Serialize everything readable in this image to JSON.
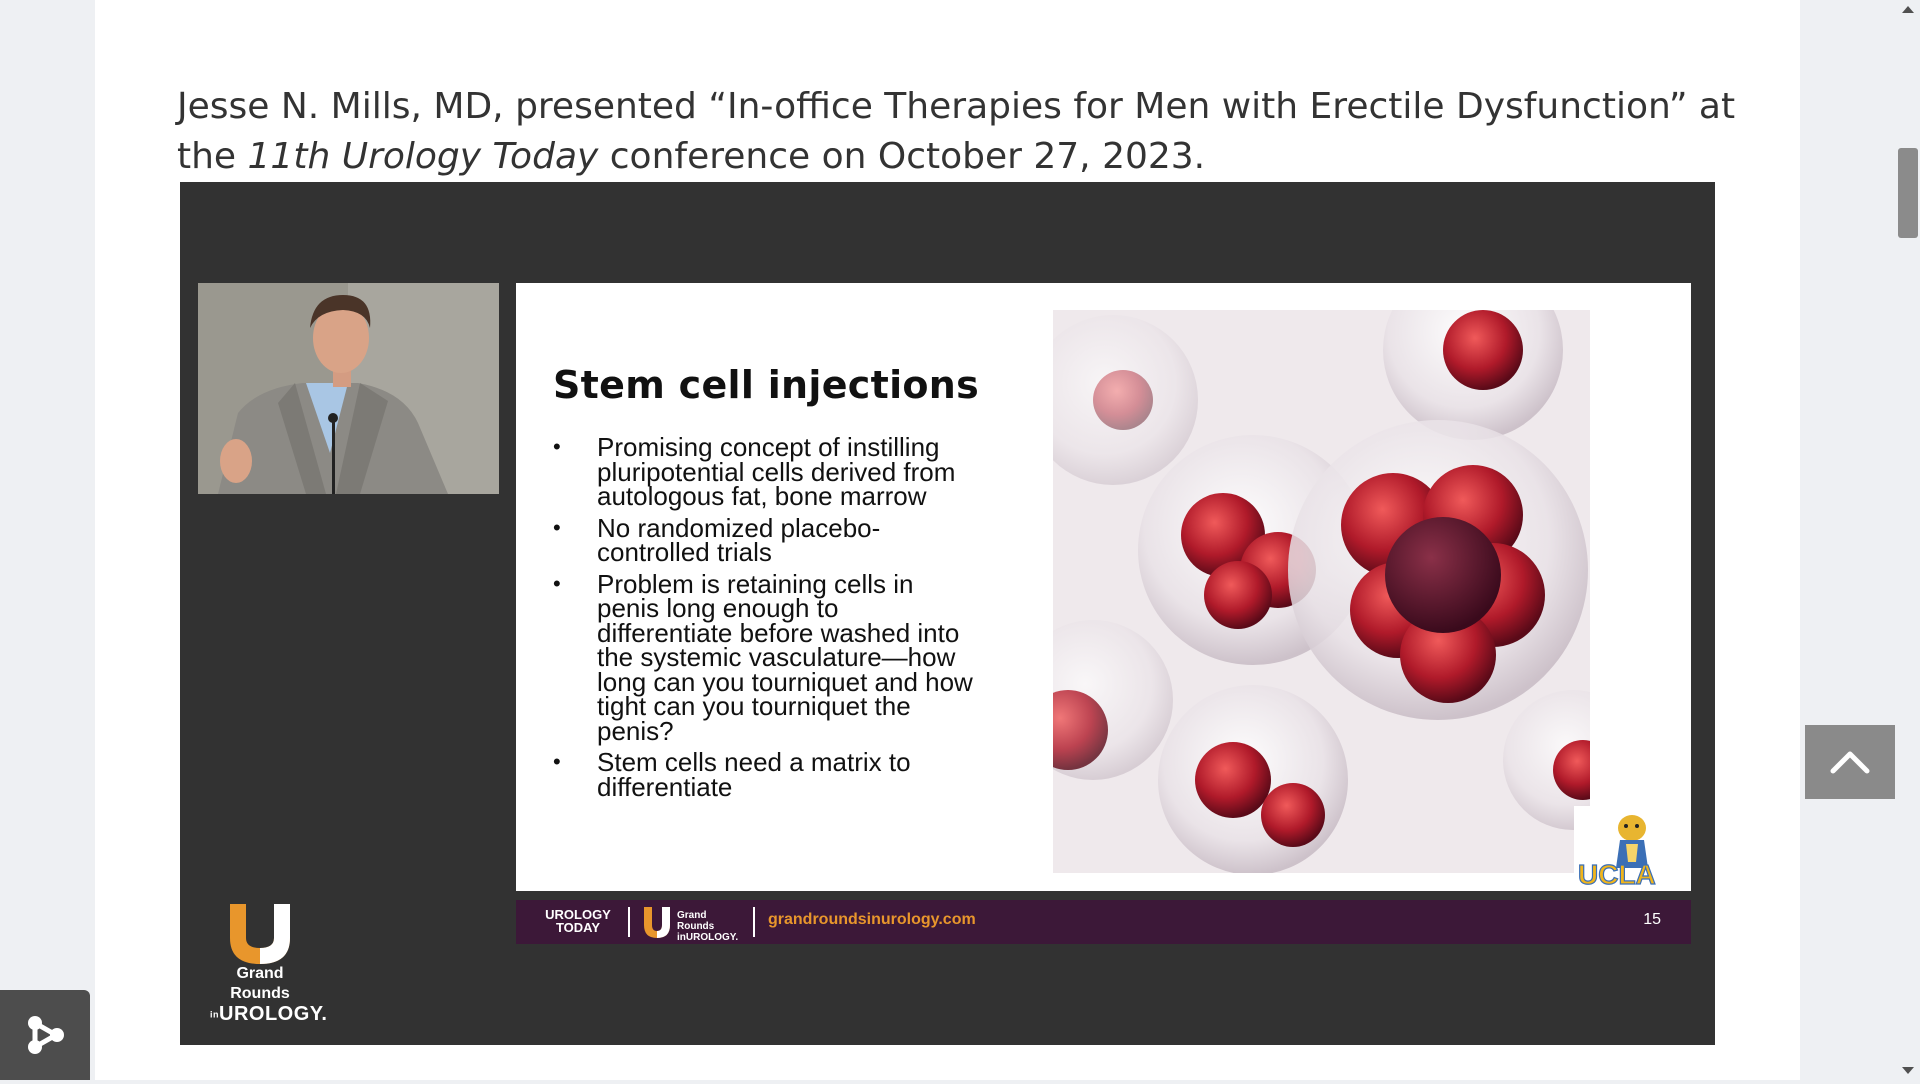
{
  "article": {
    "intro_part1": "Jesse N. Mills, MD, presented “In-office Therapies for Men with Erectile Dysfunction” at the ",
    "intro_conference": "11th Urology Today",
    "intro_part2": " conference on October 27, 2023."
  },
  "slide": {
    "title": "Stem cell injections",
    "bullet_marker": "•",
    "bullets": [
      "Promising concept of instilling pluripotential cells derived from autologous fat, bone marrow",
      "No randomized placebo-controlled trials",
      "Problem is retaining cells in penis long enough to differentiate before washed into the systemic vasculature—how long can you tourniquet and how tight can you tourniquet the penis?",
      "Stem cells need a matrix to differentiate"
    ],
    "ucla_logo_text": "UCLA",
    "footer": {
      "urology_today_line1": "UROLOGY",
      "urology_today_line2": "TODAY",
      "grand_rounds_line1": "Grand Rounds",
      "grand_rounds_in": "in",
      "grand_rounds_line2": "UROLOGY.",
      "url": "grandroundsinurology.com",
      "slide_number": "15"
    }
  },
  "video_logo": {
    "line1": "Grand Rounds",
    "in": "in",
    "line2": "UROLOGY."
  },
  "icons": {
    "scroll_up": "triangle-up-icon",
    "scroll_down": "triangle-down-icon",
    "back_to_top": "chevron-up-icon",
    "share": "share-nodes-icon"
  },
  "colors": {
    "accent_orange": "#e8962c",
    "footer_purple": "#3c1838",
    "video_bg": "#323232",
    "text": "#333333"
  }
}
